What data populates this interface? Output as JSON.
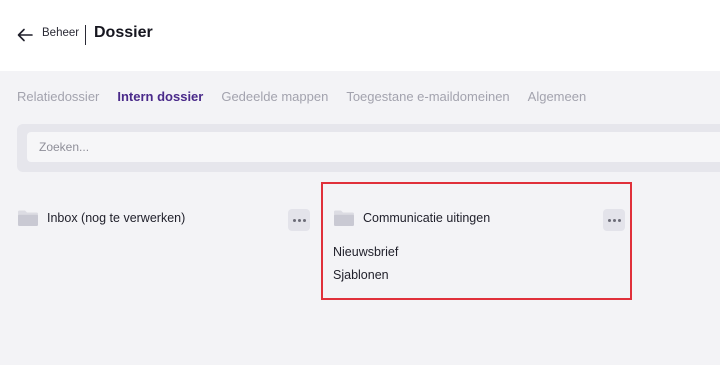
{
  "header": {
    "back_icon": "arrow-left-icon",
    "breadcrumb": "Beheer",
    "title": "Dossier"
  },
  "tabs": [
    {
      "label": "Relatiedossier",
      "active": false
    },
    {
      "label": "Intern dossier",
      "active": true
    },
    {
      "label": "Gedeelde mappen",
      "active": false
    },
    {
      "label": "Toegestane e-maildomeinen",
      "active": false
    },
    {
      "label": "Algemeen",
      "active": false
    }
  ],
  "search": {
    "placeholder": "Zoeken...",
    "value": ""
  },
  "folders": [
    {
      "name": "Inbox (nog te verwerken)",
      "icon": "folder-icon",
      "subfolders": []
    },
    {
      "name": "Communicatie uitingen",
      "icon": "folder-icon",
      "subfolders": [
        "Nieuwsbrief",
        "Sjablonen"
      ]
    }
  ],
  "colors": {
    "accent": "#4a2a8a",
    "highlight_border": "#e0303a",
    "background": "#f3f3f6",
    "tab_inactive": "#a3a3ae"
  }
}
